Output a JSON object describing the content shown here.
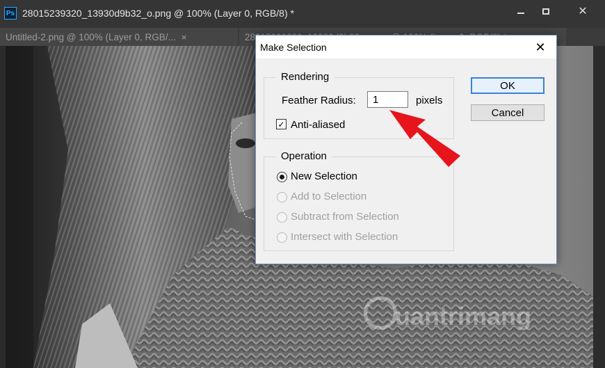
{
  "app": {
    "logo_text": "Ps",
    "window_title": "28015239320_13930d9b32_o.png @ 100% (Layer 0, RGB/8) *"
  },
  "tabs": [
    {
      "label": "Untitled-2.png @ 100% (Layer 0, RGB/...",
      "close": "×"
    },
    {
      "label": "28015239320_13930d9b32_o.png @ 100% (Layer 0, RGB/8) *",
      "close": "×"
    }
  ],
  "window_controls": {
    "close": "✕"
  },
  "dialog": {
    "title": "Make Selection",
    "close": "✕",
    "rendering": {
      "legend": "Rendering",
      "feather_label": "Feather Radius:",
      "feather_value": "1",
      "feather_unit": "pixels",
      "anti_aliased_label": "Anti-aliased",
      "anti_aliased_checked": true,
      "check_glyph": "✓"
    },
    "operation": {
      "legend": "Operation",
      "options": [
        {
          "label": "New Selection",
          "selected": true,
          "enabled": true
        },
        {
          "label": "Add to Selection",
          "selected": false,
          "enabled": false
        },
        {
          "label": "Subtract from Selection",
          "selected": false,
          "enabled": false
        },
        {
          "label": "Intersect with Selection",
          "selected": false,
          "enabled": false
        }
      ]
    },
    "buttons": {
      "ok": "OK",
      "cancel": "Cancel"
    }
  },
  "watermark": "uantrimang",
  "colors": {
    "annotation_arrow": "#e8141b",
    "ok_border": "#3c7fd9"
  }
}
